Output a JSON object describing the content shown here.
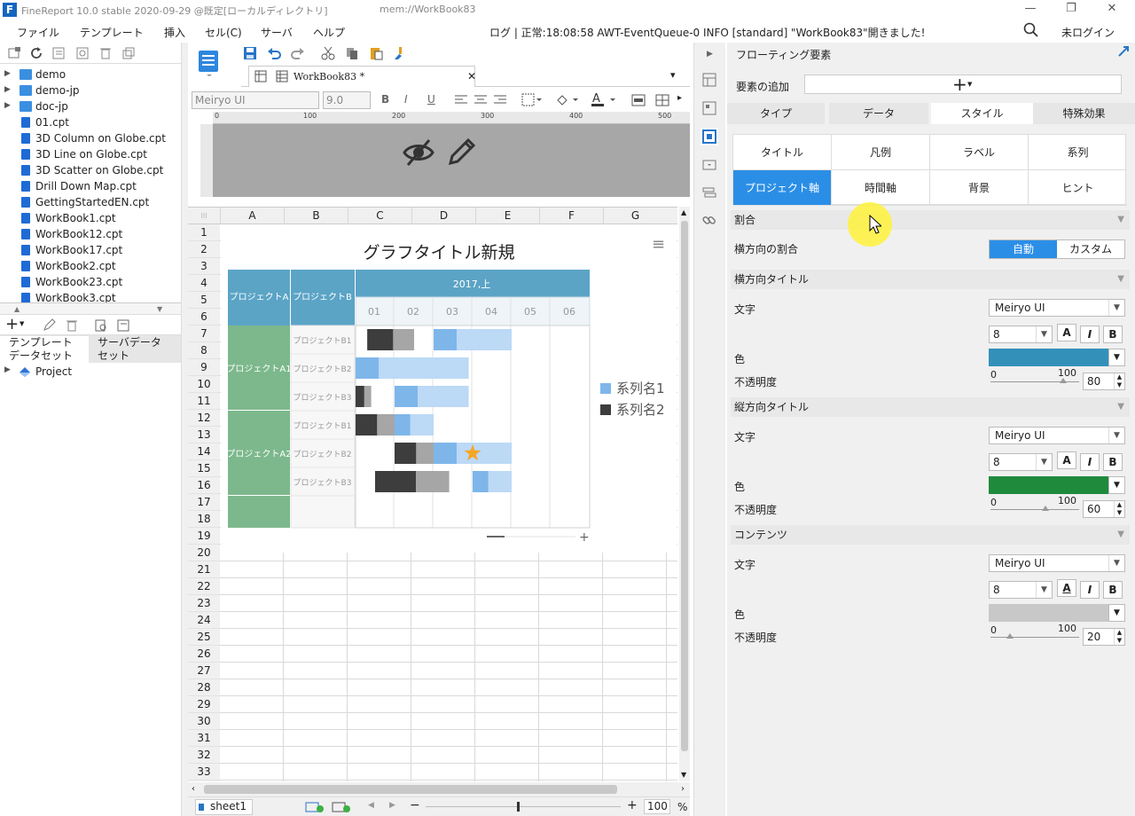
{
  "window": {
    "title": "FineReport 10.0 stable 2020-09-29 @既定[ローカルディレクトリ]",
    "workbook_path": "mem://WorkBook83",
    "logo": "F"
  },
  "menu": {
    "items": [
      "ファイル",
      "テンプレート",
      "挿入",
      "セル(C)",
      "サーバ",
      "ヘルプ"
    ],
    "status_message": "ログ | 正常:18:08:58 AWT-EventQueue-0 INFO [standard] \"WorkBook83\"開きました!",
    "login": "未ログイン"
  },
  "tree": {
    "items": [
      {
        "label": "demo",
        "type": "folder"
      },
      {
        "label": "demo-jp",
        "type": "folder"
      },
      {
        "label": "doc-jp",
        "type": "folder"
      },
      {
        "label": "01.cpt",
        "type": "file"
      },
      {
        "label": "3D Column on Globe.cpt",
        "type": "file"
      },
      {
        "label": "3D Line on Globe.cpt",
        "type": "file"
      },
      {
        "label": "3D Scatter on Globe.cpt",
        "type": "file"
      },
      {
        "label": "Drill Down Map.cpt",
        "type": "file"
      },
      {
        "label": "GettingStartedEN.cpt",
        "type": "file"
      },
      {
        "label": "WorkBook1.cpt",
        "type": "file"
      },
      {
        "label": "WorkBook12.cpt",
        "type": "file"
      },
      {
        "label": "WorkBook17.cpt",
        "type": "file"
      },
      {
        "label": "WorkBook2.cpt",
        "type": "file"
      },
      {
        "label": "WorkBook23.cpt",
        "type": "file"
      },
      {
        "label": "WorkBook3.cpt",
        "type": "file"
      }
    ]
  },
  "dataset_panel": {
    "tabs": [
      "テンプレート\nデータセット",
      "サーバデータ\nセット"
    ],
    "project": "Project"
  },
  "editor": {
    "tab_label": "WorkBook83 *",
    "font": "Meiryo UI",
    "font_size": "9.0",
    "ruler_ticks": [
      "0",
      "100",
      "200",
      "300",
      "400",
      "500"
    ],
    "columns": [
      "A",
      "B",
      "C",
      "D",
      "E",
      "F",
      "G"
    ],
    "rows": [
      "1",
      "2",
      "3",
      "4",
      "5",
      "6",
      "7",
      "8",
      "9",
      "10",
      "11",
      "12",
      "13",
      "14",
      "15",
      "16",
      "17",
      "18",
      "19",
      "20",
      "21",
      "22",
      "23",
      "24",
      "25",
      "26",
      "27",
      "28",
      "29",
      "30",
      "31",
      "32",
      "33"
    ],
    "sheet_name": "sheet1",
    "zoom": "100",
    "zoom_unit": "%"
  },
  "chart": {
    "title": "グラフタイトル新規",
    "header_a": "プロジェクトA",
    "header_b": "プロジェクトB",
    "period": "2017,上",
    "months": [
      "01",
      "02",
      "03",
      "04",
      "05",
      "06"
    ],
    "groups": [
      "プロジェクトA1",
      "プロジェクトA2"
    ],
    "subitems": [
      "プロジェクトB1",
      "プロジェクトB2",
      "プロジェクトB3",
      "プロジェクトB1",
      "プロジェクトB2",
      "プロジェクトB3"
    ],
    "legend": [
      "系列名1",
      "系列名2"
    ],
    "colors": {
      "header": "#5ba4c6",
      "group": "#7cb88c",
      "series1": "#7eb6ea",
      "series1_light": "#bcd9f6",
      "series2": "#3d3d3d",
      "series2_light": "#a6a6a6",
      "star": "#f5a623"
    }
  },
  "chart_data": {
    "type": "bar",
    "title": "グラフタイトル新規",
    "categories": [
      "プロジェクトA1 / プロジェクトB1",
      "プロジェクトA1 / プロジェクトB2",
      "プロジェクトA1 / プロジェクトB3",
      "プロジェクトA2 / プロジェクトB1",
      "プロジェクトA2 / プロジェクトB2",
      "プロジェクトA2 / プロジェクトB3"
    ],
    "x_categories": [
      "01",
      "02",
      "03",
      "04",
      "05",
      "06"
    ],
    "series": [
      {
        "name": "系列名1",
        "ranges": [
          [
            2.0,
            4.0
          ],
          [
            0.0,
            2.9
          ],
          [
            1.0,
            2.9
          ],
          [
            1.0,
            2.0
          ],
          [
            2.0,
            4.0
          ],
          [
            3.0,
            4.0
          ]
        ]
      },
      {
        "name": "系列名2",
        "ranges": [
          [
            0.3,
            1.5
          ],
          [],
          [
            0.0,
            0.4
          ],
          [
            0.0,
            1.0
          ],
          [
            1.0,
            2.0
          ],
          [
            0.5,
            2.4
          ]
        ]
      }
    ]
  },
  "right_panel": {
    "title": "フローティング要素",
    "add_label": "要素の追加",
    "main_tabs": [
      "タイプ",
      "データ",
      "スタイル",
      "特殊効果"
    ],
    "sub_tabs": [
      "タイトル",
      "凡例",
      "ラベル",
      "系列",
      "プロジェクト軸",
      "時間軸",
      "背景",
      "ヒント"
    ],
    "sections": {
      "ratio": {
        "title": "割合",
        "label": "横方向の割合",
        "options": [
          "自動",
          "カスタム"
        ]
      },
      "h_title": {
        "title": "横方向タイトル",
        "text_label": "文字",
        "font": "Meiryo UI",
        "size": "8",
        "color_label": "色",
        "color": "#3391b9",
        "opacity_label": "不透明度",
        "opacity": "80",
        "slider_min": "0",
        "slider_max": "100"
      },
      "v_title": {
        "title": "縦方向タイトル",
        "text_label": "文字",
        "font": "Meiryo UI",
        "size": "8",
        "color_label": "色",
        "color": "#1f8a3c",
        "opacity_label": "不透明度",
        "opacity": "60",
        "slider_min": "0",
        "slider_max": "100"
      },
      "content": {
        "title": "コンテンツ",
        "text_label": "文字",
        "font": "Meiryo UI",
        "size": "8",
        "color_label": "色",
        "color": "#c8c8c8",
        "opacity_label": "不透明度",
        "opacity": "20",
        "slider_min": "0",
        "slider_max": "100"
      }
    },
    "style_buttons": [
      "A",
      "I",
      "B"
    ]
  }
}
